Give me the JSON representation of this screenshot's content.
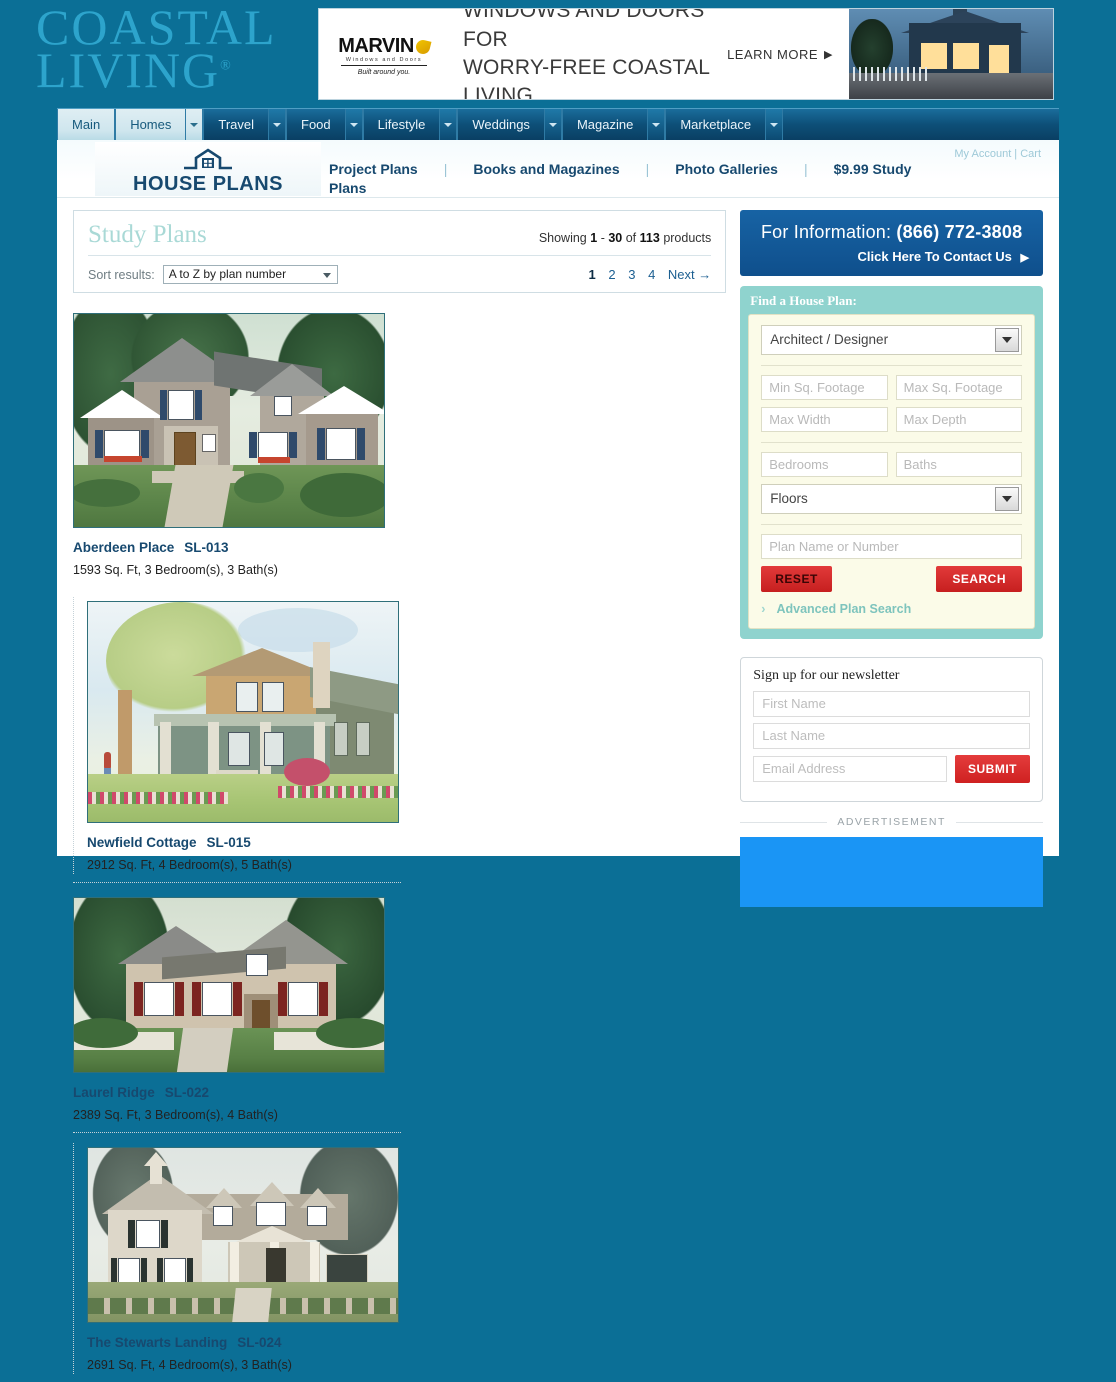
{
  "brand": {
    "line1": "COASTAL",
    "line2": "LIVING",
    "tm": "®"
  },
  "banner": {
    "advertiser": "MARVIN",
    "advertiser_sub": "Windows and Doors",
    "advertiser_tagline": "Built around you.",
    "headline_line1": "WINDOWS AND DOORS FOR",
    "headline_line2": "WORRY-FREE COASTAL LIVING",
    "cta": "LEARN MORE",
    "cta_arrow": "▶"
  },
  "mainnav": {
    "items": [
      {
        "label": "Main",
        "caret": false,
        "active": false
      },
      {
        "label": "Homes",
        "caret": true,
        "active": true
      },
      {
        "label": "Travel",
        "caret": true,
        "active": false
      },
      {
        "label": "Food",
        "caret": true,
        "active": false
      },
      {
        "label": "Lifestyle",
        "caret": true,
        "active": false
      },
      {
        "label": "Weddings",
        "caret": true,
        "active": false
      },
      {
        "label": "Magazine",
        "caret": true,
        "active": false
      },
      {
        "label": "Marketplace",
        "caret": true,
        "active": false
      }
    ]
  },
  "subnav": {
    "logo_text": "HOUSE PLANS",
    "account": "My Account | Cart",
    "links": [
      {
        "label": "Project Plans",
        "wrap": "Plans"
      },
      {
        "label": "Books and Magazines",
        "wrap": ""
      },
      {
        "label": "Photo Galleries",
        "wrap": ""
      },
      {
        "label": "$9.99 Study",
        "wrap": ""
      }
    ],
    "separator": "|"
  },
  "listing": {
    "title": "Study Plans",
    "showing_prefix": "Showing",
    "showing_from": "1",
    "showing_dash": "-",
    "showing_to": "30",
    "showing_of": "of",
    "showing_total": "113",
    "showing_suffix": "products",
    "sort_label": "Sort results:",
    "sort_value": "A to Z by plan number",
    "sort_options": [
      "A to Z by plan number"
    ],
    "pages": [
      "1",
      "2",
      "3",
      "4"
    ],
    "current_page": "1",
    "next_label": "Next →"
  },
  "products": [
    {
      "name": "Aberdeen Place",
      "number": "SL-013",
      "meta": "1593 Sq. Ft, 3 Bedroom(s), 3 Bath(s)",
      "style": "cottage-stone"
    },
    {
      "name": "Newfield Cottage",
      "number": "SL-015",
      "meta": "2912 Sq. Ft, 4 Bedroom(s), 5 Bath(s)",
      "style": "watercolor-bungalow"
    },
    {
      "name": "Laurel Ridge",
      "number": "SL-022",
      "meta": "2389 Sq. Ft, 3 Bedroom(s), 4 Bath(s)",
      "style": "shingle-craftsman"
    },
    {
      "name": "The Stewarts Landing",
      "number": "SL-024",
      "meta": "2691 Sq. Ft, 4 Bedroom(s), 3 Bath(s)",
      "style": "photo-farmhouse"
    }
  ],
  "info": {
    "label": "For Information:",
    "phone": "(866) 772-3808",
    "contact": "Click Here To Contact Us",
    "arrow": "▶"
  },
  "find": {
    "title": "Find a House Plan:",
    "architect_value": "Architect / Designer",
    "min_sqft": "Min Sq. Footage",
    "max_sqft": "Max Sq. Footage",
    "max_width": "Max Width",
    "max_depth": "Max Depth",
    "bedrooms": "Bedrooms",
    "baths": "Baths",
    "floors_value": "Floors",
    "plan_name": "Plan Name or Number",
    "reset": "RESET",
    "search": "SEARCH",
    "advanced": "Advanced Plan Search",
    "advanced_chevron": "›"
  },
  "newsletter": {
    "title": "Sign up for our newsletter",
    "first_name": "First Name",
    "last_name": "Last Name",
    "email": "Email Address",
    "submit": "SUBMIT"
  },
  "ad": {
    "label": "ADVERTISEMENT"
  },
  "colors": {
    "page_background": "#0b6f96",
    "nav_blue": "#0d4f78",
    "heading_teal": "#a9d9d6",
    "link_blue": "#17496f",
    "accent_red": "#cf2121",
    "find_teal": "#8fd3ce",
    "ad_blue": "#1a95f5"
  }
}
